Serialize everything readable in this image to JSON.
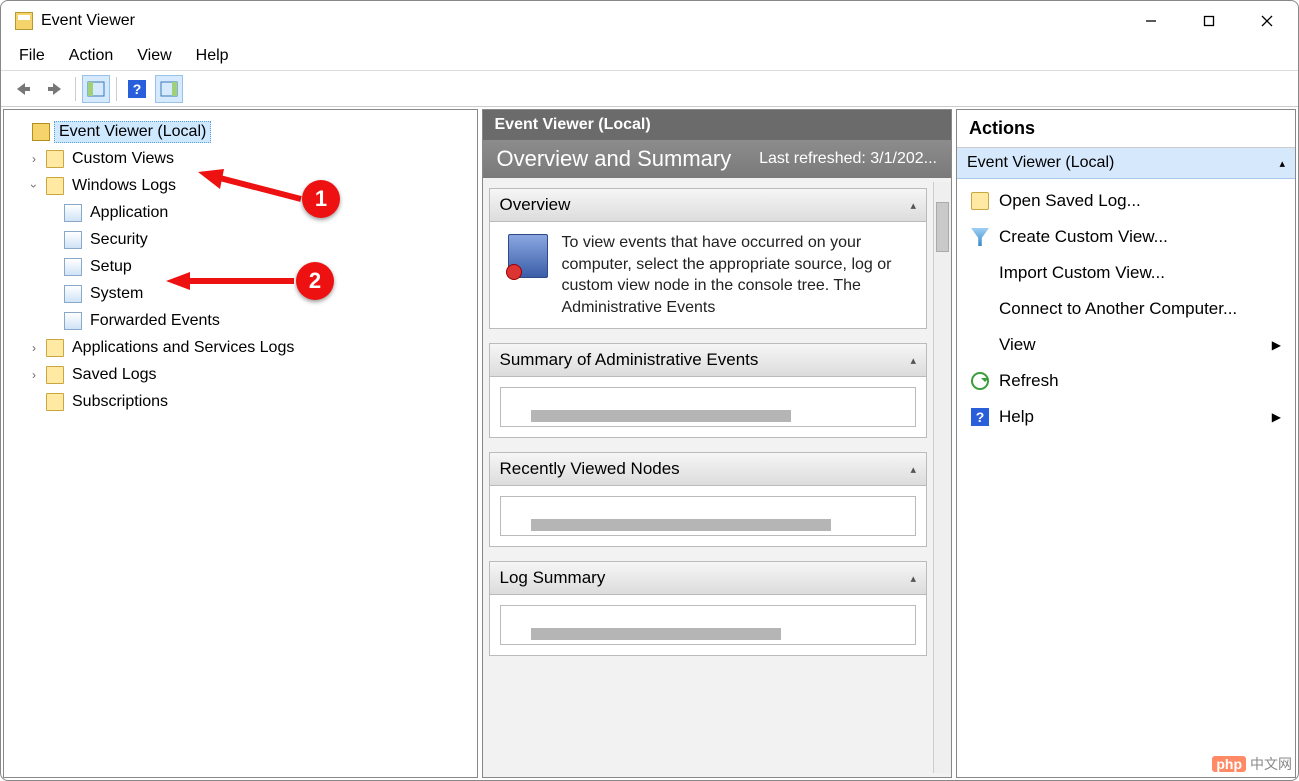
{
  "window": {
    "title": "Event Viewer"
  },
  "menu": {
    "file": "File",
    "action": "Action",
    "view": "View",
    "help": "Help"
  },
  "tree": {
    "root": "Event Viewer (Local)",
    "custom_views": "Custom Views",
    "windows_logs": "Windows Logs",
    "logs": {
      "application": "Application",
      "security": "Security",
      "setup": "Setup",
      "system": "System",
      "forwarded": "Forwarded Events"
    },
    "apps_services": "Applications and Services Logs",
    "saved_logs": "Saved Logs",
    "subscriptions": "Subscriptions"
  },
  "center": {
    "header": "Event Viewer (Local)",
    "overview_title": "Overview and Summary",
    "last_refreshed": "Last refreshed: 3/1/202...",
    "sections": {
      "overview": "Overview",
      "overview_text": "To view events that have occurred on your computer, select the appropriate source, log or custom view node in the console tree. The Administrative Events",
      "summary": "Summary of Administrative Events",
      "recent": "Recently Viewed Nodes",
      "logsummary": "Log Summary"
    }
  },
  "actions": {
    "header": "Actions",
    "context": "Event Viewer (Local)",
    "items": {
      "open_saved": "Open Saved Log...",
      "create_view": "Create Custom View...",
      "import_view": "Import Custom View...",
      "connect": "Connect to Another Computer...",
      "view": "View",
      "refresh": "Refresh",
      "help": "Help"
    }
  },
  "annotations": {
    "one": "1",
    "two": "2"
  },
  "watermark": {
    "php": "php",
    "text": "中文网"
  }
}
